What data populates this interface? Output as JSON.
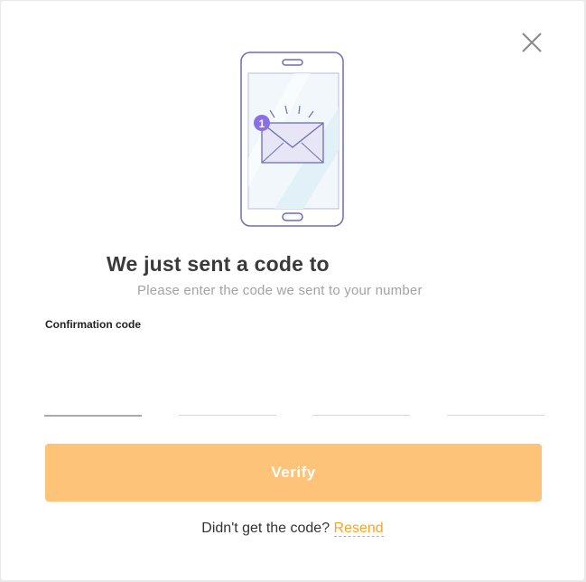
{
  "modal": {
    "close_icon": "close-icon",
    "illustration_icon": "phone-envelope-illustration",
    "badge_count": "1",
    "title": "We just sent a code to",
    "subtitle": "Please enter the code we sent to your number",
    "code_label": "Confirmation code",
    "code_digits": [
      "",
      "",
      "",
      ""
    ],
    "verify_label": "Verify",
    "resend_prompt": "Didn't get the code? ",
    "resend_label": "Resend"
  },
  "colors": {
    "accent": "#f5a623",
    "button_bg": "#fdc379",
    "illustration_stroke": "#6b6fb3",
    "badge": "#8a6fe8"
  }
}
